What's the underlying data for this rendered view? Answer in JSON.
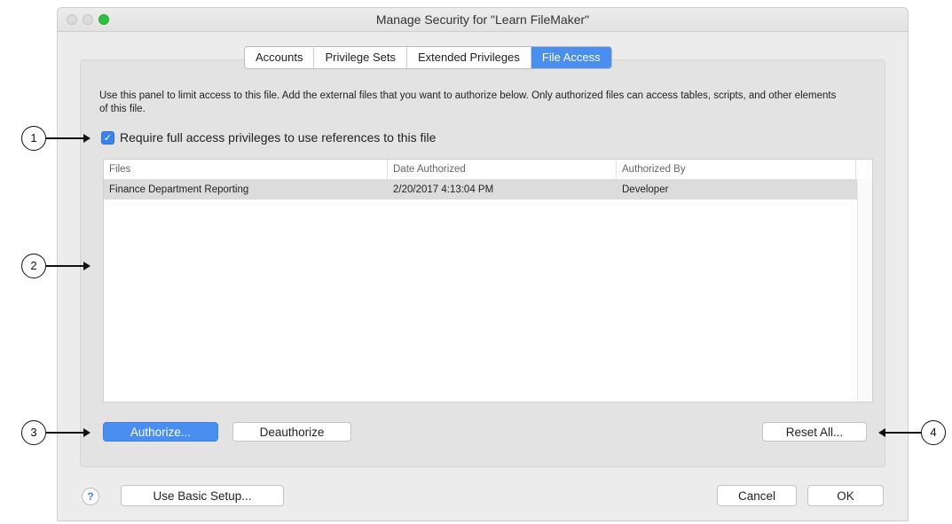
{
  "window": {
    "title": "Manage Security for \"Learn FileMaker\""
  },
  "tabs": [
    {
      "label": "Accounts"
    },
    {
      "label": "Privilege Sets"
    },
    {
      "label": "Extended Privileges"
    },
    {
      "label": "File Access",
      "active": true
    }
  ],
  "description": "Use this panel to limit access to this file.  Add the external files that you want to authorize below.  Only authorized files can access tables, scripts, and other elements of this file.",
  "checkbox": {
    "label": "Require full access privileges to use references to this file",
    "checked": true
  },
  "table": {
    "columns": [
      "Files",
      "Date Authorized",
      "Authorized By"
    ],
    "rows": [
      [
        "Finance Department Reporting",
        "2/20/2017 4:13:04 PM",
        "Developer"
      ]
    ]
  },
  "buttons": {
    "authorize": "Authorize...",
    "deauthorize": "Deauthorize",
    "reset_all": "Reset All...",
    "use_basic_setup": "Use Basic Setup...",
    "cancel": "Cancel",
    "ok": "OK",
    "help": "?"
  },
  "callouts": [
    "1",
    "2",
    "3",
    "4"
  ],
  "colors": {
    "accent": "#4a8ff0",
    "zoom_button": "#2fc043"
  },
  "icons": {
    "checkbox": "checkmark-icon",
    "help": "question-mark-icon"
  }
}
